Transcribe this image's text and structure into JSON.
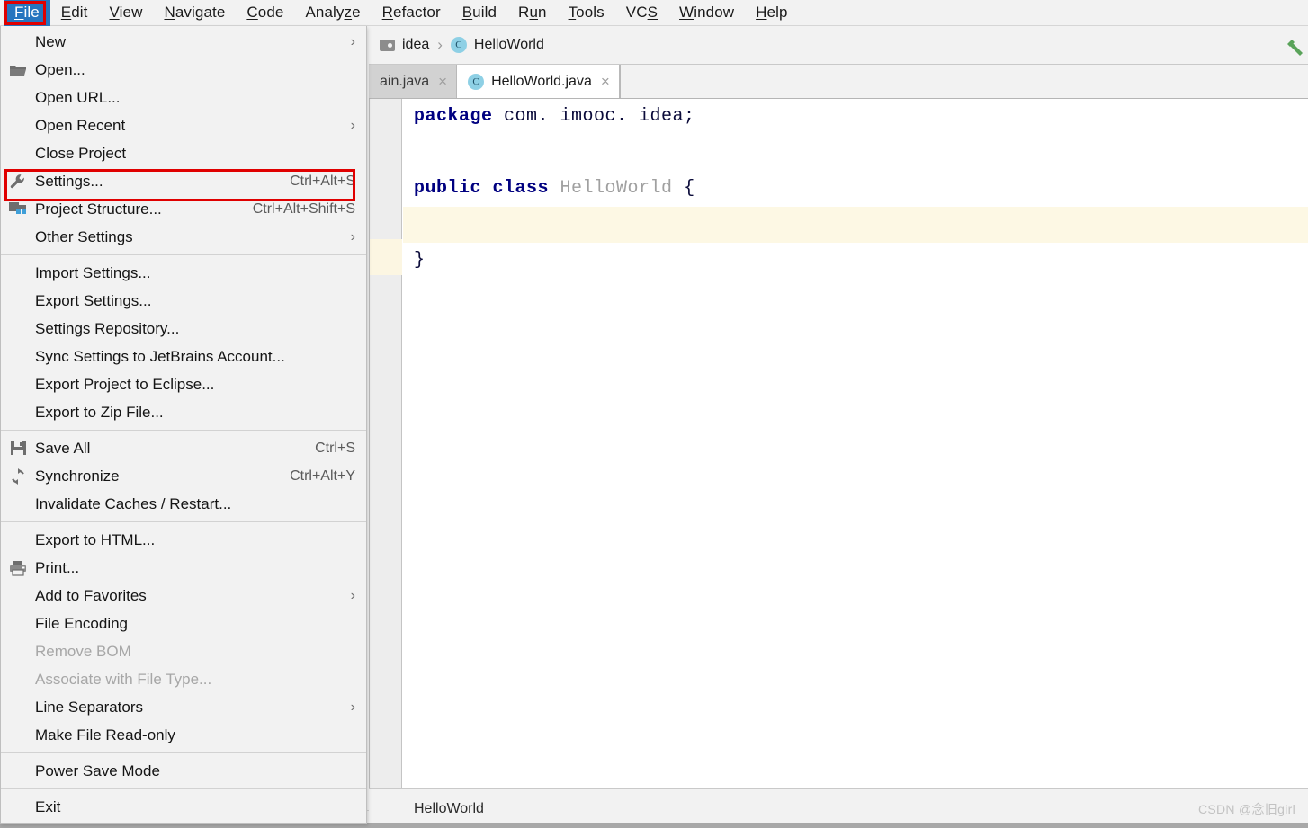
{
  "menubar": {
    "items": [
      {
        "label": "File",
        "mnemonic": "F",
        "active": true
      },
      {
        "label": "Edit",
        "mnemonic": "E",
        "active": false
      },
      {
        "label": "View",
        "mnemonic": "V",
        "active": false
      },
      {
        "label": "Navigate",
        "mnemonic": "N",
        "active": false
      },
      {
        "label": "Code",
        "mnemonic": "C",
        "active": false
      },
      {
        "label": "Analyze",
        "mnemonic": "z",
        "active": false
      },
      {
        "label": "Refactor",
        "mnemonic": "R",
        "active": false
      },
      {
        "label": "Build",
        "mnemonic": "B",
        "active": false
      },
      {
        "label": "Run",
        "mnemonic": "u",
        "active": false
      },
      {
        "label": "Tools",
        "mnemonic": "T",
        "active": false
      },
      {
        "label": "VCS",
        "mnemonic": "S",
        "active": false
      },
      {
        "label": "Window",
        "mnemonic": "W",
        "active": false
      },
      {
        "label": "Help",
        "mnemonic": "H",
        "active": false
      }
    ]
  },
  "file_menu": {
    "groups": [
      {
        "items": [
          {
            "label": "New",
            "icon": "none",
            "accel": "",
            "submenu": true,
            "disabled": false
          },
          {
            "label": "Open...",
            "icon": "folder-icon",
            "accel": "",
            "submenu": false,
            "disabled": false
          },
          {
            "label": "Open URL...",
            "icon": "none",
            "accel": "",
            "submenu": false,
            "disabled": false
          },
          {
            "label": "Open Recent",
            "icon": "none",
            "accel": "",
            "submenu": true,
            "disabled": false
          },
          {
            "label": "Close Project",
            "icon": "none",
            "accel": "",
            "submenu": false,
            "disabled": false
          },
          {
            "label": "Settings...",
            "icon": "wrench-icon",
            "accel": "Ctrl+Alt+S",
            "submenu": false,
            "disabled": false,
            "highlighted": true
          },
          {
            "label": "Project Structure...",
            "icon": "module-icon",
            "accel": "Ctrl+Alt+Shift+S",
            "submenu": false,
            "disabled": false
          },
          {
            "label": "Other Settings",
            "icon": "none",
            "accel": "",
            "submenu": true,
            "disabled": false
          }
        ]
      },
      {
        "items": [
          {
            "label": "Import Settings...",
            "icon": "none",
            "accel": "",
            "submenu": false,
            "disabled": false
          },
          {
            "label": "Export Settings...",
            "icon": "none",
            "accel": "",
            "submenu": false,
            "disabled": false
          },
          {
            "label": "Settings Repository...",
            "icon": "none",
            "accel": "",
            "submenu": false,
            "disabled": false
          },
          {
            "label": "Sync Settings to JetBrains Account...",
            "icon": "none",
            "accel": "",
            "submenu": false,
            "disabled": false
          },
          {
            "label": "Export Project to Eclipse...",
            "icon": "none",
            "accel": "",
            "submenu": false,
            "disabled": false
          },
          {
            "label": "Export to Zip File...",
            "icon": "none",
            "accel": "",
            "submenu": false,
            "disabled": false
          }
        ]
      },
      {
        "items": [
          {
            "label": "Save All",
            "icon": "save-icon",
            "accel": "Ctrl+S",
            "submenu": false,
            "disabled": false
          },
          {
            "label": "Synchronize",
            "icon": "synchronize-icon",
            "accel": "Ctrl+Alt+Y",
            "submenu": false,
            "disabled": false
          },
          {
            "label": "Invalidate Caches / Restart...",
            "icon": "none",
            "accel": "",
            "submenu": false,
            "disabled": false
          }
        ]
      },
      {
        "items": [
          {
            "label": "Export to HTML...",
            "icon": "none",
            "accel": "",
            "submenu": false,
            "disabled": false
          },
          {
            "label": "Print...",
            "icon": "printer-icon",
            "accel": "",
            "submenu": false,
            "disabled": false
          },
          {
            "label": "Add to Favorites",
            "icon": "none",
            "accel": "",
            "submenu": true,
            "disabled": false
          },
          {
            "label": "File Encoding",
            "icon": "none",
            "accel": "",
            "submenu": false,
            "disabled": false
          },
          {
            "label": "Remove BOM",
            "icon": "none",
            "accel": "",
            "submenu": false,
            "disabled": true
          },
          {
            "label": "Associate with File Type...",
            "icon": "none",
            "accel": "",
            "submenu": false,
            "disabled": true
          },
          {
            "label": "Line Separators",
            "icon": "none",
            "accel": "",
            "submenu": true,
            "disabled": false
          },
          {
            "label": "Make File Read-only",
            "icon": "none",
            "accel": "",
            "submenu": false,
            "disabled": false
          }
        ]
      },
      {
        "items": [
          {
            "label": "Power Save Mode",
            "icon": "none",
            "accel": "",
            "submenu": false,
            "disabled": false
          }
        ]
      },
      {
        "items": [
          {
            "label": "Exit",
            "icon": "none",
            "accel": "",
            "submenu": false,
            "disabled": false
          }
        ]
      }
    ]
  },
  "breadcrumb": {
    "project": "idea",
    "separator": "›",
    "class": "HelloWorld",
    "class_icon_letter": "C"
  },
  "tabs": [
    {
      "label": "ain.java",
      "active": false,
      "close": "×",
      "icon": "none"
    },
    {
      "label": "HelloWorld.java",
      "active": true,
      "close": "×",
      "icon": "class-icon",
      "icon_letter": "C"
    }
  ],
  "editor": {
    "lines": [
      {
        "segments": [
          {
            "text": "package",
            "type": "kw"
          },
          {
            "text": " com. imooc. idea;",
            "type": "plain"
          }
        ],
        "caret": false
      },
      {
        "segments": [],
        "caret": false
      },
      {
        "segments": [
          {
            "text": "public class ",
            "type": "kw"
          },
          {
            "text": "HelloWorld",
            "type": "cls"
          },
          {
            "text": " {",
            "type": "plain"
          }
        ],
        "caret": false
      },
      {
        "segments": [],
        "caret": true
      },
      {
        "segments": [
          {
            "text": "}",
            "type": "plain"
          }
        ],
        "caret": false
      }
    ]
  },
  "statusbar": {
    "text": "HelloWorld",
    "watermark": "CSDN @念旧girl"
  },
  "colors": {
    "menu_active_bg": "#2675bf",
    "annotation_red": "#e00000",
    "menu_bg": "#f2f2f2",
    "editor_bg": "#ffffff",
    "caret_line": "#fdf8e4",
    "keyword": "#000080",
    "class_name": "#a0a0a0",
    "build_icon_green": "#5aa35a"
  }
}
